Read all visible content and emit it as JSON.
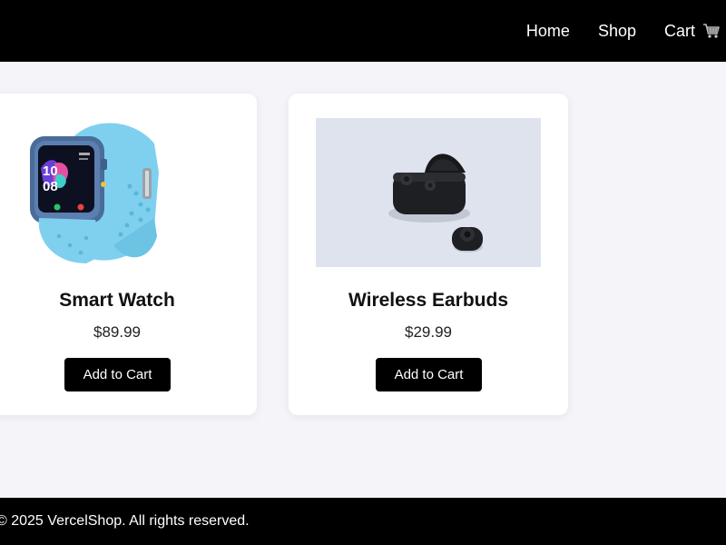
{
  "nav": {
    "items": [
      {
        "label": "Home"
      },
      {
        "label": "Shop"
      },
      {
        "label": "Cart",
        "icon": "cart-icon"
      }
    ]
  },
  "products": [
    {
      "name": "Smart Watch",
      "price": "$89.99",
      "button_label": "Add to Cart",
      "image": "smart-watch-image"
    },
    {
      "name": "Wireless Earbuds",
      "price": "$29.99",
      "button_label": "Add to Cart",
      "image": "wireless-earbuds-image"
    }
  ],
  "footer": {
    "text": "© 2025 VercelShop. All rights reserved."
  },
  "colors": {
    "header_bg": "#000000",
    "page_bg": "#f5f5f9",
    "button_bg": "#000000",
    "watch_band": "#7fd0ef",
    "earbuds_bg": "#dfe3ee"
  }
}
